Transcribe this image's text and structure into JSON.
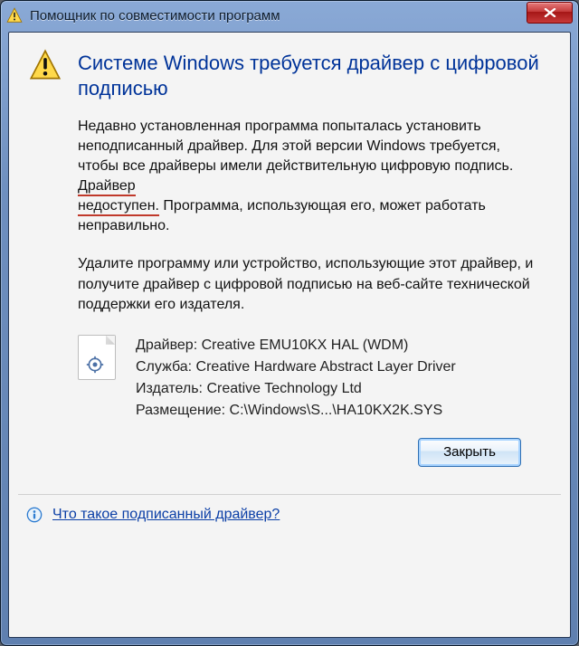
{
  "titlebar": {
    "title": "Помощник по совместимости программ"
  },
  "heading": "Системе Windows требуется драйвер с цифровой подписью",
  "para1_a": "Недавно установленная программа попыталась установить неподписанный драйвер. Для этой версии Windows требуется, чтобы все драйверы имели действительную цифровую подпись. ",
  "para1_u1": "Драйвер ",
  "para1_u2": "недоступен.",
  "para1_b": " Программа, использующая его, может работать неправильно.",
  "para2": "Удалите программу или устройство, использующие этот драйвер, и получите драйвер с цифровой подписью на веб-сайте технической поддержки его издателя.",
  "details": {
    "driver_label": "Драйвер:",
    "driver_value": "Creative EMU10KX HAL (WDM)",
    "service_label": "Служба:",
    "service_value": "Creative Hardware Abstract Layer Driver",
    "publisher_label": "Издатель:",
    "publisher_value": "Creative Technology Ltd",
    "location_label": "Размещение:",
    "location_value": "C:\\Windows\\S...\\HA10KX2K.SYS"
  },
  "buttons": {
    "close": "Закрыть"
  },
  "footer": {
    "link": "Что такое подписанный драйвер?"
  }
}
